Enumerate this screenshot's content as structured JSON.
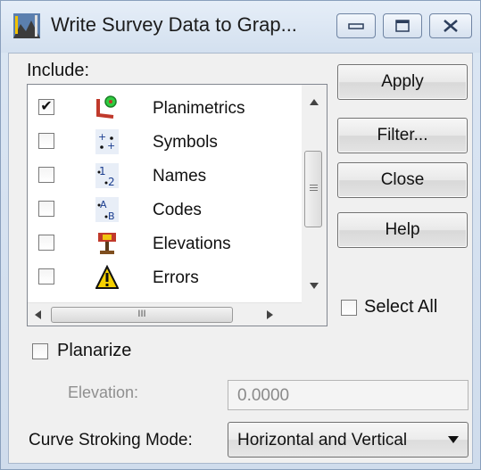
{
  "window": {
    "title": "Write Survey Data to Grap...",
    "icon": "survey-app-icon"
  },
  "include": {
    "label": "Include:",
    "items": [
      {
        "label": "Planimetrics",
        "checked": true,
        "icon": "planimetrics-icon"
      },
      {
        "label": "Symbols",
        "checked": false,
        "icon": "symbols-icon"
      },
      {
        "label": "Names",
        "checked": false,
        "icon": "names-icon"
      },
      {
        "label": "Codes",
        "checked": false,
        "icon": "codes-icon"
      },
      {
        "label": "Elevations",
        "checked": false,
        "icon": "elevations-icon"
      },
      {
        "label": "Errors",
        "checked": false,
        "icon": "errors-icon"
      }
    ],
    "hscroll_grip": "III"
  },
  "buttons": {
    "apply": "Apply",
    "filter": "Filter...",
    "close": "Close",
    "help": "Help"
  },
  "select_all": {
    "label": "Select All",
    "checked": false
  },
  "planarize": {
    "label": "Planarize",
    "checked": false
  },
  "elevation": {
    "label": "Elevation:",
    "value": "0.0000",
    "disabled": true
  },
  "curve_stroking": {
    "label": "Curve Stroking Mode:",
    "value": "Horizontal and Vertical"
  }
}
